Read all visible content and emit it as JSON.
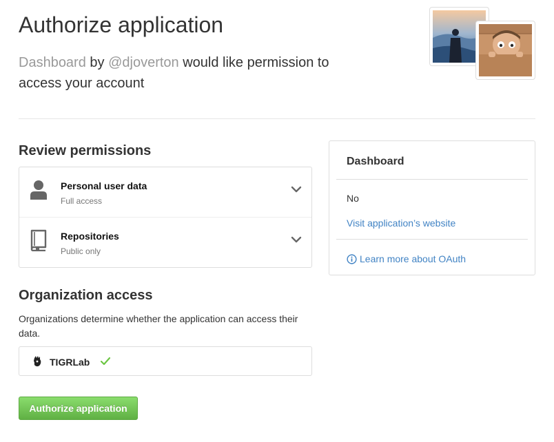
{
  "header": {
    "title": "Authorize application",
    "app_name": "Dashboard",
    "by": "by",
    "owner": "@djoverton",
    "request_text": "would like permission to access your account"
  },
  "review": {
    "title": "Review permissions",
    "items": [
      {
        "name": "Personal user data",
        "access": "Full access",
        "icon": "person-icon"
      },
      {
        "name": "Repositories",
        "access": "Public only",
        "icon": "repo-icon"
      }
    ]
  },
  "organization": {
    "title": "Organization access",
    "description": "Organizations determine whether the application can access their data.",
    "orgs": [
      {
        "name": "TIGRLab",
        "granted": true,
        "icon": "org-logo-icon"
      }
    ]
  },
  "actions": {
    "authorize_label": "Authorize application"
  },
  "side": {
    "app_title": "Dashboard",
    "status": "No",
    "website_link": "Visit application’s website",
    "learn_link": "Learn more about OAuth",
    "learn_icon": "info-icon"
  },
  "colors": {
    "link": "#4183c4",
    "button_green": "#60b044",
    "check_green": "#6cc644",
    "muted": "#999999"
  }
}
